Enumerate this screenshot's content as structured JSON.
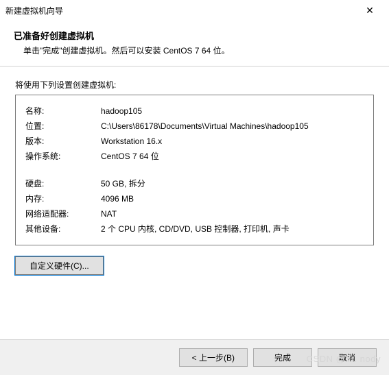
{
  "window": {
    "title": "新建虚拟机向导",
    "close_glyph": "✕"
  },
  "header": {
    "title": "已准备好创建虚拟机",
    "subtitle": "单击\"完成\"创建虚拟机。然后可以安装 CentOS 7 64 位。"
  },
  "intro": "将使用下列设置创建虚拟机:",
  "settings": {
    "name_label": "名称:",
    "name_value": "hadoop105",
    "location_label": "位置:",
    "location_value": "C:\\Users\\86178\\Documents\\Virtual Machines\\hadoop105",
    "version_label": "版本:",
    "version_value": "Workstation 16.x",
    "os_label": "操作系统:",
    "os_value": "CentOS 7 64 位",
    "disk_label": "硬盘:",
    "disk_value": "50 GB, 拆分",
    "memory_label": "内存:",
    "memory_value": "4096 MB",
    "network_label": "网络适配器:",
    "network_value": "NAT",
    "other_label": "其他设备:",
    "other_value": "2 个 CPU 内核, CD/DVD, USB 控制器, 打印机, 声卡"
  },
  "buttons": {
    "customize": "自定义硬件(C)...",
    "back": "< 上一步(B)",
    "finish": "完成",
    "cancel": "取消"
  },
  "watermark": "CSDN @Yt. nody"
}
